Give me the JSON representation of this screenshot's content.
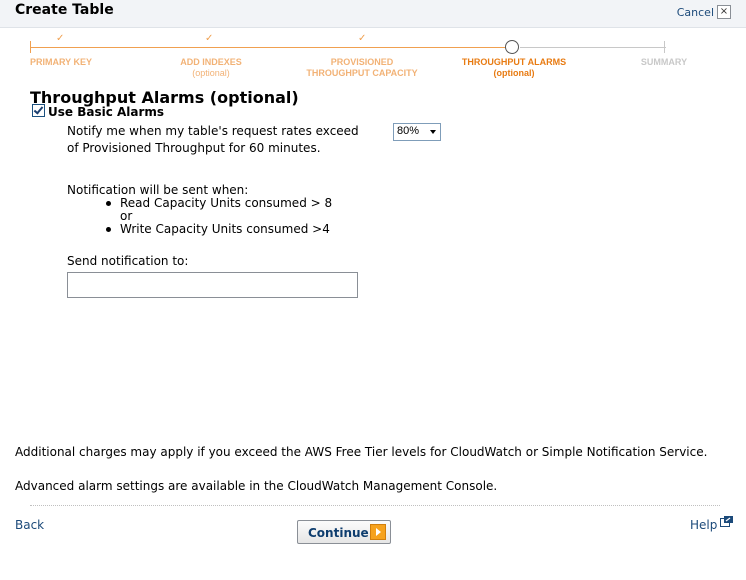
{
  "dialog": {
    "title": "Create Table",
    "cancel_label": "Cancel",
    "close_symbol": "×"
  },
  "wizard": {
    "check_symbol": "✓",
    "steps": [
      {
        "label": "PRIMARY KEY",
        "sub": "",
        "state": "done"
      },
      {
        "label": "ADD INDEXES",
        "sub": "(optional)",
        "state": "done"
      },
      {
        "label": "PROVISIONED",
        "sub": "THROUGHPUT CAPACITY",
        "state": "done"
      },
      {
        "label": "THROUGHPUT ALARMS",
        "sub": "(optional)",
        "state": "active"
      },
      {
        "label": "SUMMARY",
        "sub": "",
        "state": "future"
      }
    ]
  },
  "section": {
    "heading": "Throughput Alarms (optional)",
    "use_basic_alarms_label": "Use Basic Alarms",
    "use_basic_alarms_checked": true,
    "notify_text": "Notify me when my table's request rates exceed",
    "threshold_value": "80%",
    "notify_text_2": "of Provisioned Throughput for 60 minutes.",
    "notification_heading": "Notification will be sent when:",
    "conditions": [
      "Read Capacity Units consumed > 8",
      "Write Capacity Units consumed >4"
    ],
    "or_text": "or",
    "send_to_label": "Send notification to:",
    "send_to_value": ""
  },
  "footer": {
    "charges_note": "Additional charges may apply if you exceed the AWS Free Tier levels for CloudWatch or Simple Notification Service.",
    "advanced_note": "Advanced alarm settings are available in the CloudWatch Management Console.",
    "back_label": "Back",
    "continue_label": "Continue",
    "help_label": "Help"
  },
  "colors": {
    "accent_orange": "#e87b12",
    "link_blue": "#1c4a7a"
  }
}
